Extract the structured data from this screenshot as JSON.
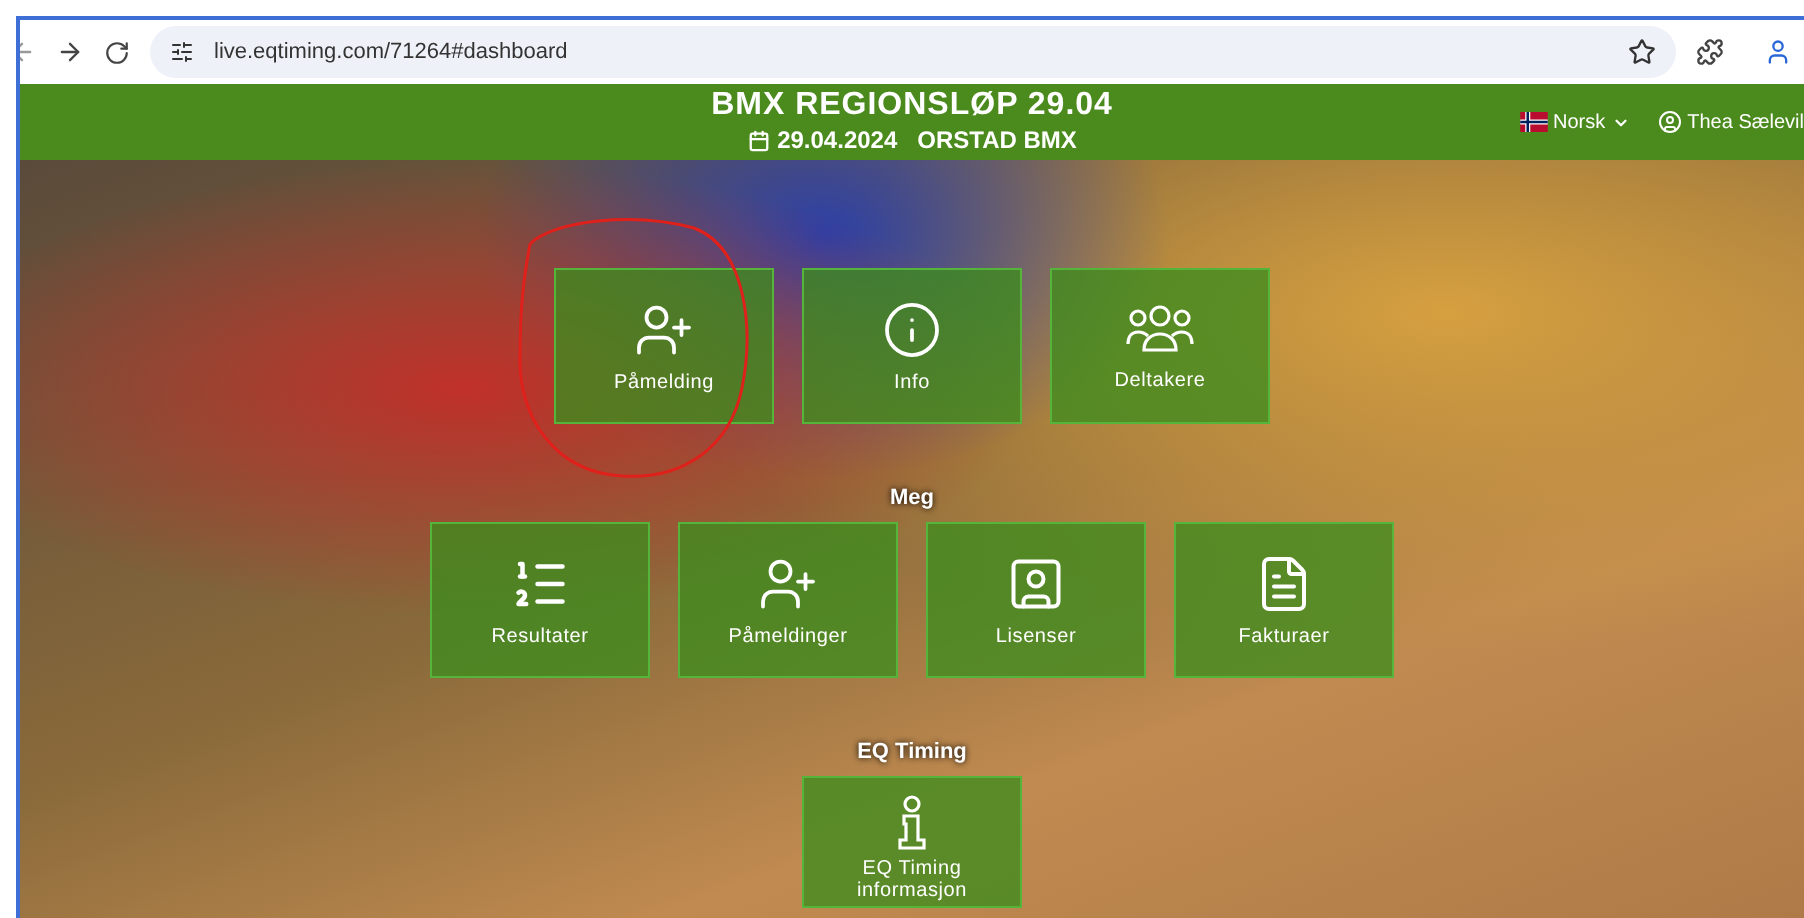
{
  "browser": {
    "url": "live.eqtiming.com/71264#dashboard"
  },
  "header": {
    "title": "BMX REGIONSLØP 29.04",
    "date": "29.04.2024",
    "venue": "ORSTAD BMX",
    "language": "Norsk",
    "user": "Thea Sælevil"
  },
  "sections": [
    {
      "tiles": [
        {
          "label": "Påmelding",
          "kind": "signup",
          "annotated": true
        },
        {
          "label": "Info",
          "kind": "info",
          "annotated": false
        },
        {
          "label": "Deltakere",
          "kind": "people",
          "annotated": false
        }
      ]
    },
    {
      "heading": "Meg",
      "tiles": [
        {
          "label": "Resultater",
          "kind": "results",
          "annotated": false
        },
        {
          "label": "Påmeldinger",
          "kind": "signup",
          "annotated": false
        },
        {
          "label": "Lisenser",
          "kind": "license",
          "annotated": false
        },
        {
          "label": "Fakturaer",
          "kind": "invoice",
          "annotated": false
        }
      ]
    },
    {
      "heading": "EQ Timing",
      "tiles": [
        {
          "label": "EQ Timing informasjon",
          "kind": "about",
          "annotated": false
        }
      ]
    }
  ]
}
